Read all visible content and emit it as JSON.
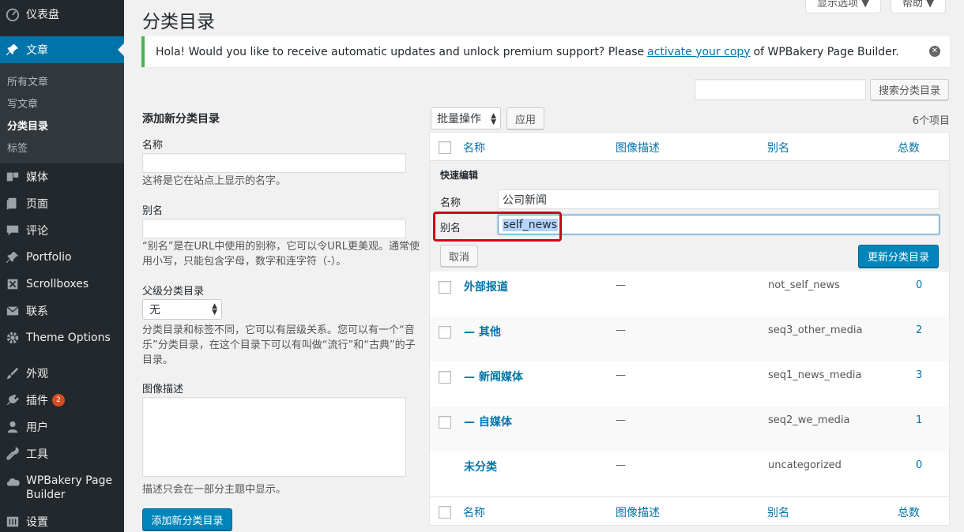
{
  "sidebar": {
    "dashboard": "仪表盘",
    "posts": "文章",
    "posts_sub": [
      "所有文章",
      "写文章",
      "分类目录",
      "标签"
    ],
    "media": "媒体",
    "pages": "页面",
    "comments": "评论",
    "portfolio": "Portfolio",
    "scrollboxes": "Scrollboxes",
    "contact": "联系",
    "theme_options": "Theme Options",
    "appearance": "外观",
    "plugins": "插件",
    "plugins_badge": "2",
    "users": "用户",
    "tools": "工具",
    "wpbakery": "WPBakery Page Builder",
    "settings": "设置"
  },
  "header": {
    "screen_options": "显示选项 ▼",
    "help": "帮助 ▼",
    "title": "分类目录"
  },
  "notice": {
    "text_before": "Hola! Would you like to receive automatic updates and unlock premium support? Please ",
    "link": "activate your copy",
    "text_after": " of WPBakery Page Builder."
  },
  "search": {
    "button": "搜索分类目录"
  },
  "add_form": {
    "heading": "添加新分类目录",
    "name_label": "名称",
    "name_help": "这将是它在站点上显示的名字。",
    "slug_label": "别名",
    "slug_help": "“别名”是在URL中使用的别称，它可以令URL更美观。通常使用小写，只能包含字母，数字和连字符（-）。",
    "parent_label": "父级分类目录",
    "parent_value": "无",
    "parent_help": "分类目录和标签不同，它可以有层级关系。您可以有一个“音乐”分类目录，在这个目录下可以有叫做“流行”和“古典”的子目录。",
    "desc_label": "图像描述",
    "desc_help": "描述只会在一部分主题中显示。",
    "submit": "添加新分类目录"
  },
  "table": {
    "bulk_action": "批量操作",
    "apply": "应用",
    "count": "6个项目",
    "columns": [
      "名称",
      "图像描述",
      "别名",
      "总数"
    ],
    "quick_edit": {
      "title": "快速编辑",
      "name_label": "名称",
      "name_value": "公司新闻",
      "slug_label": "别名",
      "slug_value": "self_news",
      "cancel": "取消",
      "update": "更新分类目录"
    },
    "rows": [
      {
        "name": "外部报道",
        "desc": "—",
        "slug": "not_self_news",
        "count": "0"
      },
      {
        "name": "— 其他",
        "desc": "—",
        "slug": "seq3_other_media",
        "count": "2"
      },
      {
        "name": "— 新闻媒体",
        "desc": "—",
        "slug": "seq1_news_media",
        "count": "3"
      },
      {
        "name": "— 自媒体",
        "desc": "—",
        "slug": "seq2_we_media",
        "count": "1"
      },
      {
        "name": "未分类",
        "desc": "—",
        "slug": "uncategorized",
        "count": "0"
      }
    ]
  }
}
